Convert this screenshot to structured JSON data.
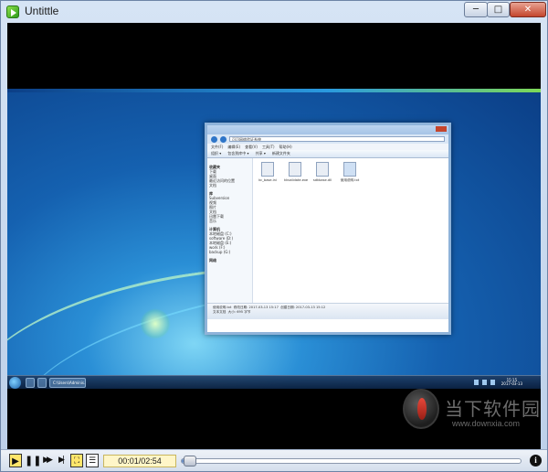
{
  "window": {
    "title": "Untittle"
  },
  "titlebar_buttons": {
    "minimize": "─",
    "maximize": "□",
    "close": "✕"
  },
  "explorer": {
    "address": "可可网络验证系统",
    "menu": [
      "文件(F)",
      "编辑(E)",
      "查看(V)",
      "工具(T)",
      "帮助(H)"
    ],
    "toolbar": [
      "组织 ▾",
      "包含到库中 ▾",
      "共享 ▾",
      "新建文件夹"
    ],
    "nav": [
      {
        "group": true,
        "label": "收藏夹"
      },
      {
        "label": "下载"
      },
      {
        "label": "桌面"
      },
      {
        "label": "最近访问的位置"
      },
      {
        "label": "文档"
      },
      {
        "group": true,
        "label": "库"
      },
      {
        "label": "Subversion"
      },
      {
        "label": "视频"
      },
      {
        "label": "图片"
      },
      {
        "label": "文档"
      },
      {
        "label": "迅雷下载"
      },
      {
        "label": "音乐"
      },
      {
        "group": true,
        "label": "计算机"
      },
      {
        "label": "本地磁盘 (C:)"
      },
      {
        "label": "software (D:)"
      },
      {
        "label": "本地磁盘 (E:)"
      },
      {
        "label": "work (F:)"
      },
      {
        "label": "backup (G:)"
      },
      {
        "group": true,
        "label": "网络"
      }
    ],
    "files": [
      {
        "name": "kc_base.ini",
        "selected": false
      },
      {
        "name": "kkvalidate.exe",
        "selected": false
      },
      {
        "name": "sdkbase.dll",
        "selected": false
      },
      {
        "name": "使用说明.txt",
        "selected": true
      }
    ],
    "status": {
      "name": "使用说明.txt",
      "modified": "修改日期: 2017-03-13 15:17",
      "created": "创建日期: 2017-03-13 15:12",
      "type": "文本文档",
      "size": "大小: 695 字节"
    }
  },
  "taskbar": {
    "window_button": "C:\\Users\\Adminis...",
    "clock_time": "15:15",
    "clock_date": "2017-03-13"
  },
  "watermark": {
    "text": "当下软件园",
    "url": "www.downxia.com"
  },
  "player": {
    "time_display": "00:01/02:54",
    "progress": 0.006,
    "buttons": {
      "play": "▶",
      "pause": "❚❚",
      "forward": "▶▶",
      "end": "▶|",
      "fullscreen": "⛶",
      "playlist": "☰",
      "info": "i"
    }
  },
  "colors": {
    "accent": "#ffe66b",
    "desktop_blue": "#1561b0"
  }
}
